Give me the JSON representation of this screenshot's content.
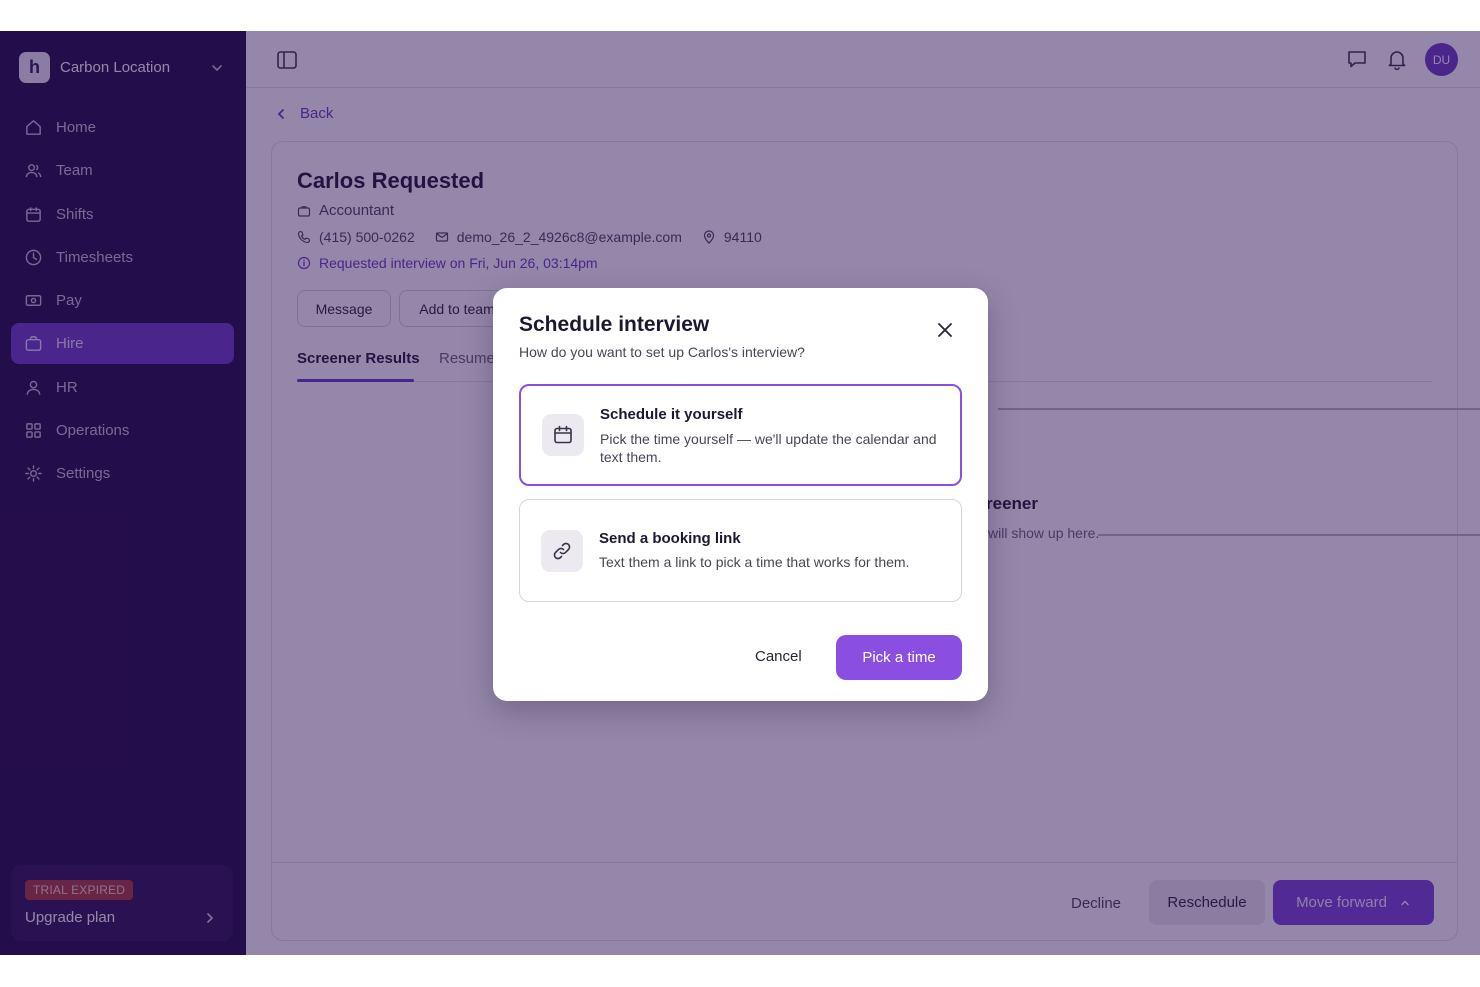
{
  "workspace": {
    "logo_letter": "h",
    "name": "Carbon Location"
  },
  "sidebar": {
    "items": [
      {
        "label": "Home",
        "icon": "home-icon"
      },
      {
        "label": "Team",
        "icon": "team-icon"
      },
      {
        "label": "Shifts",
        "icon": "calendar-icon"
      },
      {
        "label": "Timesheets",
        "icon": "clock-icon"
      },
      {
        "label": "Pay",
        "icon": "pay-icon"
      },
      {
        "label": "Hire",
        "icon": "briefcase-icon",
        "active": true
      },
      {
        "label": "HR",
        "icon": "person-icon"
      },
      {
        "label": "Operations",
        "icon": "grid-icon"
      },
      {
        "label": "Settings",
        "icon": "gear-icon"
      }
    ],
    "trial_badge": "TRIAL EXPIRED",
    "upgrade_label": "Upgrade plan"
  },
  "topbar": {
    "avatar_initials": "DU"
  },
  "back_label": "Back",
  "candidate": {
    "name": "Carlos Requested",
    "role": "Accountant",
    "phone": "(415) 500-0262",
    "email": "demo_26_2_4926c8@example.com",
    "zip": "94110",
    "status": "Requested interview on Fri, Jun 26, 03:14pm"
  },
  "actions": {
    "message": "Message",
    "add_to_team": "Add to team"
  },
  "tabs": [
    "Screener Results",
    "Resume"
  ],
  "empty_state": {
    "title": "reener",
    "subtitle": "will show up here."
  },
  "footer": {
    "decline": "Decline",
    "reschedule": "Reschedule",
    "move_forward": "Move forward"
  },
  "modal": {
    "title": "Schedule interview",
    "subtitle": "How do you want to set up Carlos's interview?",
    "options": [
      {
        "title": "Schedule it yourself",
        "description": "Pick the time yourself — we'll update the calendar and text them.",
        "selected": true
      },
      {
        "title": "Send a booking link",
        "description": "Text them a link to pick a time that works for them.",
        "selected": false
      }
    ],
    "cancel": "Cancel",
    "confirm": "Pick a time"
  },
  "colors": {
    "sidebar_bg": "#1f0a43",
    "accent": "#8a4fe0",
    "active_nav": "#6a3bc2",
    "overlay": "#2a1054"
  }
}
